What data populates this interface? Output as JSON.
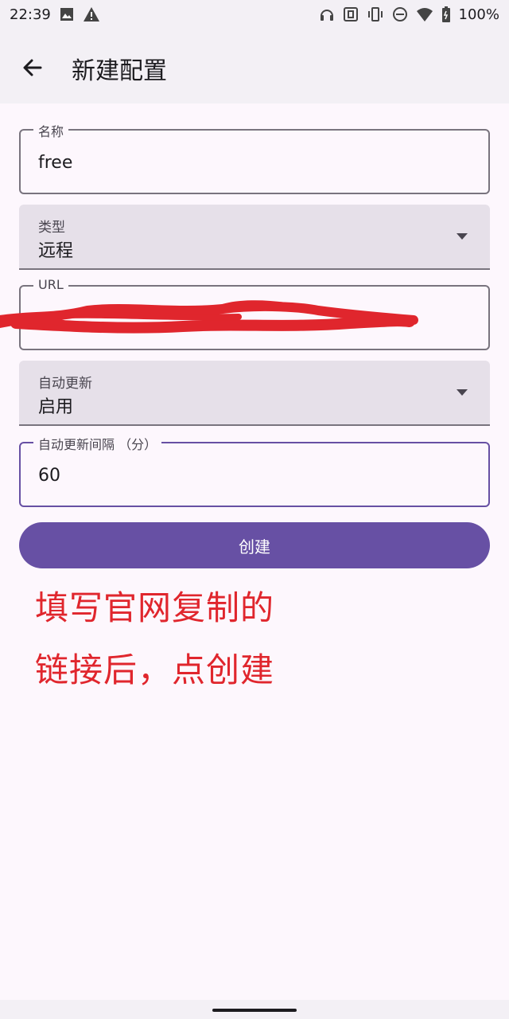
{
  "status_bar": {
    "time": "22:39",
    "battery": "100%",
    "left_icons": [
      "image-icon",
      "alert-icon"
    ],
    "right_icons": [
      "headset-icon",
      "nfc-icon",
      "vibrate-icon",
      "dnd-icon",
      "wifi-icon",
      "battery-icon"
    ]
  },
  "app_bar": {
    "title": "新建配置",
    "back_icon": "arrow-back-icon"
  },
  "form": {
    "name": {
      "label": "名称",
      "value": "free"
    },
    "type": {
      "label": "类型",
      "value": "远程"
    },
    "url": {
      "label": "URL",
      "value": ""
    },
    "auto_update": {
      "label": "自动更新",
      "value": "启用"
    },
    "interval": {
      "label": "自动更新间隔 （分）",
      "value": "60"
    }
  },
  "create_button": {
    "label": "创建"
  },
  "annotation": {
    "line1": "填写官网复制的",
    "line2": "链接后，点创建",
    "color": "#e0262d"
  },
  "colors": {
    "primary": "#6750a4",
    "background": "#fdf7fd",
    "surface_variant": "#e6e0e9"
  }
}
